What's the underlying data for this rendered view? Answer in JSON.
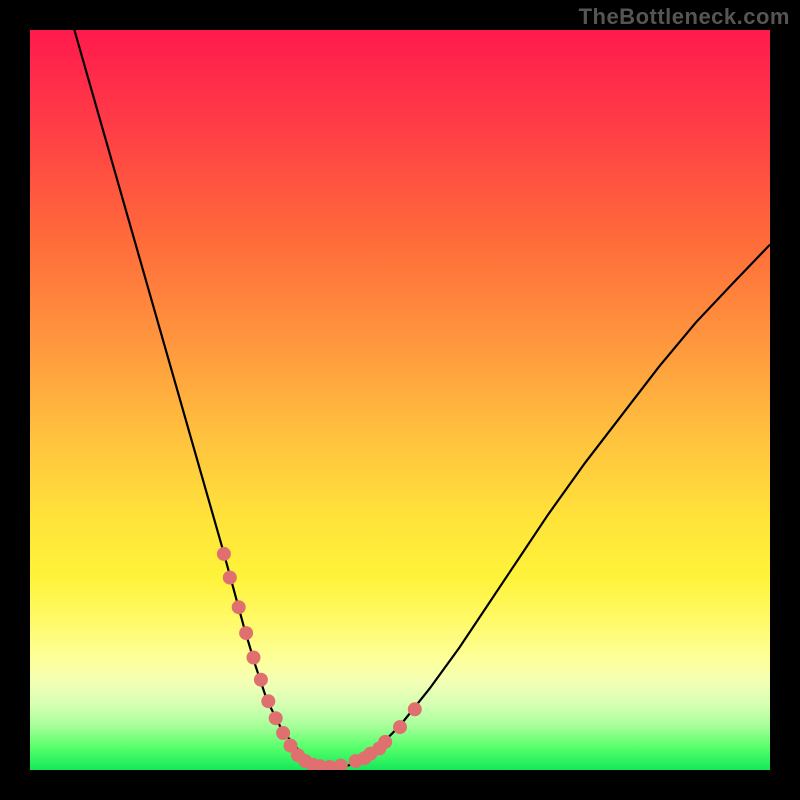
{
  "watermark": "TheBottleneck.com",
  "chart_data": {
    "type": "line",
    "title": "",
    "xlabel": "",
    "ylabel": "",
    "xlim": [
      0,
      1
    ],
    "ylim": [
      0,
      1
    ],
    "series": [
      {
        "name": "curve",
        "x": [
          0.06,
          0.08,
          0.1,
          0.12,
          0.14,
          0.16,
          0.18,
          0.2,
          0.22,
          0.24,
          0.26,
          0.275,
          0.29,
          0.305,
          0.32,
          0.34,
          0.36,
          0.38,
          0.4,
          0.43,
          0.46,
          0.5,
          0.54,
          0.58,
          0.62,
          0.66,
          0.7,
          0.75,
          0.8,
          0.85,
          0.9,
          0.95,
          1.0
        ],
        "y": [
          1.0,
          0.93,
          0.86,
          0.79,
          0.72,
          0.65,
          0.58,
          0.51,
          0.44,
          0.37,
          0.3,
          0.245,
          0.19,
          0.14,
          0.095,
          0.055,
          0.03,
          0.012,
          0.004,
          0.006,
          0.02,
          0.06,
          0.11,
          0.165,
          0.225,
          0.285,
          0.345,
          0.415,
          0.48,
          0.545,
          0.605,
          0.658,
          0.71
        ]
      },
      {
        "name": "highlight-dots",
        "x": [
          0.262,
          0.27,
          0.282,
          0.292,
          0.302,
          0.312,
          0.322,
          0.332,
          0.342,
          0.352,
          0.362,
          0.372,
          0.382,
          0.392,
          0.405,
          0.42,
          0.44,
          0.46,
          0.48,
          0.5,
          0.52,
          0.472,
          0.452
        ],
        "y": [
          0.292,
          0.26,
          0.22,
          0.185,
          0.152,
          0.122,
          0.093,
          0.07,
          0.05,
          0.033,
          0.02,
          0.012,
          0.007,
          0.005,
          0.004,
          0.006,
          0.012,
          0.022,
          0.038,
          0.058,
          0.082,
          0.029,
          0.016
        ]
      }
    ],
    "colors": {
      "curve": "#000000",
      "dots": "#e07070",
      "gradient_top": "#ff1a4d",
      "gradient_bottom": "#14e85a"
    }
  }
}
